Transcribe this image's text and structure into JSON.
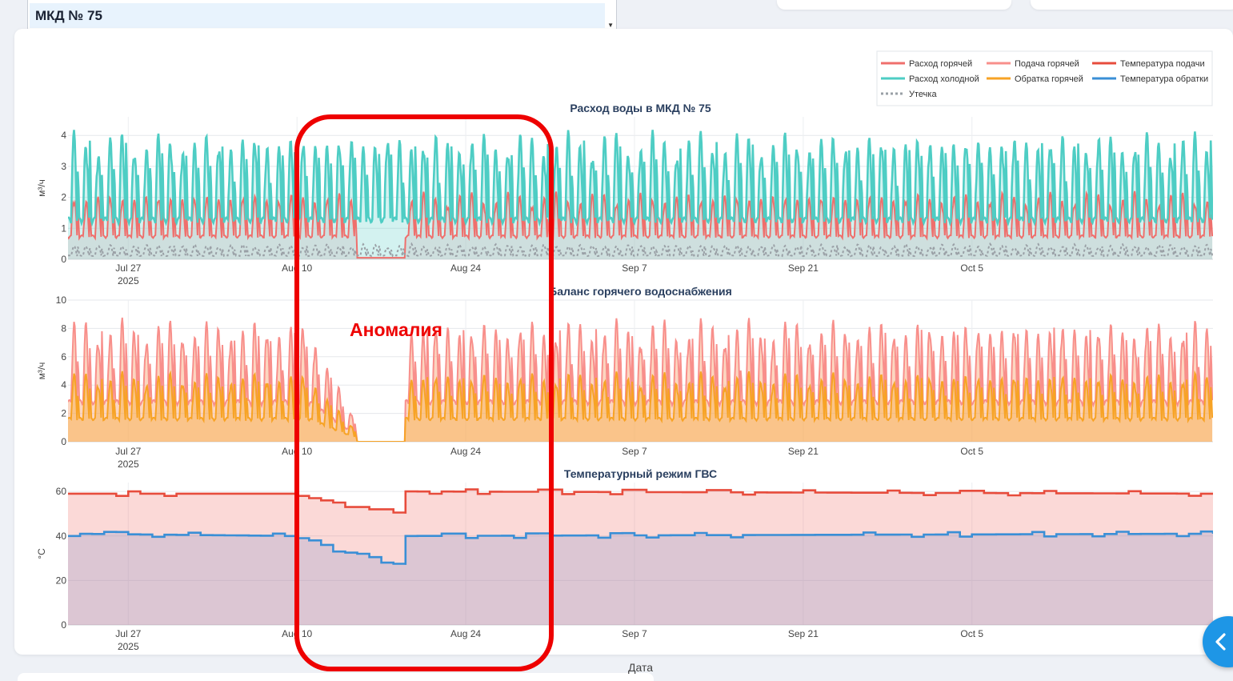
{
  "selector": {
    "selected": "МКД № 75"
  },
  "anomaly": {
    "label": "Аномалия"
  },
  "legend": [
    {
      "name": "Расход горячей",
      "color": "#ef6f6c",
      "style": "solid"
    },
    {
      "name": "Подача горячей",
      "color": "#f88f8b",
      "style": "solid"
    },
    {
      "name": "Температура подачи",
      "color": "#e74c3c",
      "style": "solid"
    },
    {
      "name": "Расход холодной",
      "color": "#4ecdc4",
      "style": "solid"
    },
    {
      "name": "Обратка горячей",
      "color": "#f7a325",
      "style": "solid"
    },
    {
      "name": "Температура обратки",
      "color": "#3a8fd6",
      "style": "solid"
    },
    {
      "name": "Утечка",
      "color": "#9aa0a6",
      "style": "dotted"
    }
  ],
  "x_axis_label": "Дата",
  "chart_data": [
    {
      "type": "line",
      "title": "Расход воды в МКД № 75",
      "ylabel": "м³/ч",
      "ylim": [
        0,
        4.6
      ],
      "yticks": [
        0,
        1,
        2,
        3,
        4
      ],
      "xlim": [
        "2025-07-22",
        "2025-10-25"
      ],
      "xticks": [
        "Jul 27",
        "Aug 10",
        "Aug 24",
        "Sep 7",
        "Sep 21",
        "Oct 5"
      ],
      "xtick_year": "2025",
      "series": [
        {
          "name": "Расход холодной",
          "pattern": "daily_peaks",
          "typical_peak": 4.2,
          "typical_min": 0.4
        },
        {
          "name": "Расход горячей",
          "pattern": "daily_peaks",
          "typical_peak": 2.2,
          "typical_min": 0.3,
          "outage": [
            "2025-08-15",
            "2025-08-19"
          ],
          "outage_value": 0.05
        },
        {
          "name": "Утечка",
          "pattern": "daily_peaks",
          "typical_peak": 0.5,
          "typical_min": 0.0
        }
      ]
    },
    {
      "type": "area",
      "title": "Баланс горячего водоснабжения",
      "ylabel": "м³/ч",
      "ylim": [
        0,
        10
      ],
      "yticks": [
        0,
        2,
        4,
        6,
        8,
        10
      ],
      "xlim": [
        "2025-07-22",
        "2025-10-25"
      ],
      "xticks": [
        "Jul 27",
        "Aug 10",
        "Aug 24",
        "Sep 7",
        "Sep 21",
        "Oct 5"
      ],
      "xtick_year": "2025",
      "series": [
        {
          "name": "Подача горячей",
          "pattern": "daily_peaks",
          "typical_peak": 8.8,
          "typical_min": 1.0,
          "degrading": [
            "2025-08-11",
            "2025-08-15"
          ],
          "outage": [
            "2025-08-15",
            "2025-08-19"
          ]
        },
        {
          "name": "Обратка горячей",
          "pattern": "daily_peaks",
          "typical_peak": 5.0,
          "typical_min": 0.6,
          "degrading": [
            "2025-08-11",
            "2025-08-15"
          ],
          "outage": [
            "2025-08-15",
            "2025-08-19"
          ]
        }
      ]
    },
    {
      "type": "area",
      "title": "Температурный режим ГВС",
      "ylabel": "°C",
      "ylim": [
        0,
        64
      ],
      "yticks": [
        0,
        20,
        40,
        60
      ],
      "xlim": [
        "2025-07-22",
        "2025-10-25"
      ],
      "xticks": [
        "Jul 27",
        "Aug 10",
        "Aug 24",
        "Sep 7",
        "Sep 21",
        "Oct 5"
      ],
      "xtick_year": "2025",
      "series": [
        {
          "name": "Температура подачи",
          "points": [
            [
              "2025-07-22",
              59
            ],
            [
              "2025-08-09",
              59
            ],
            [
              "2025-08-11",
              57
            ],
            [
              "2025-08-13",
              55
            ],
            [
              "2025-08-15",
              53
            ],
            [
              "2025-08-17",
              51
            ],
            [
              "2025-08-19",
              50
            ],
            [
              "2025-08-19",
              60
            ],
            [
              "2025-10-25",
              59
            ]
          ]
        },
        {
          "name": "Температура обратки",
          "points": [
            [
              "2025-07-22",
              41
            ],
            [
              "2025-08-09",
              40
            ],
            [
              "2025-08-11",
              38
            ],
            [
              "2025-08-13",
              34
            ],
            [
              "2025-08-15",
              31
            ],
            [
              "2025-08-17",
              28
            ],
            [
              "2025-08-19",
              27
            ],
            [
              "2025-08-19",
              40
            ],
            [
              "2025-10-25",
              41
            ]
          ]
        }
      ]
    }
  ]
}
